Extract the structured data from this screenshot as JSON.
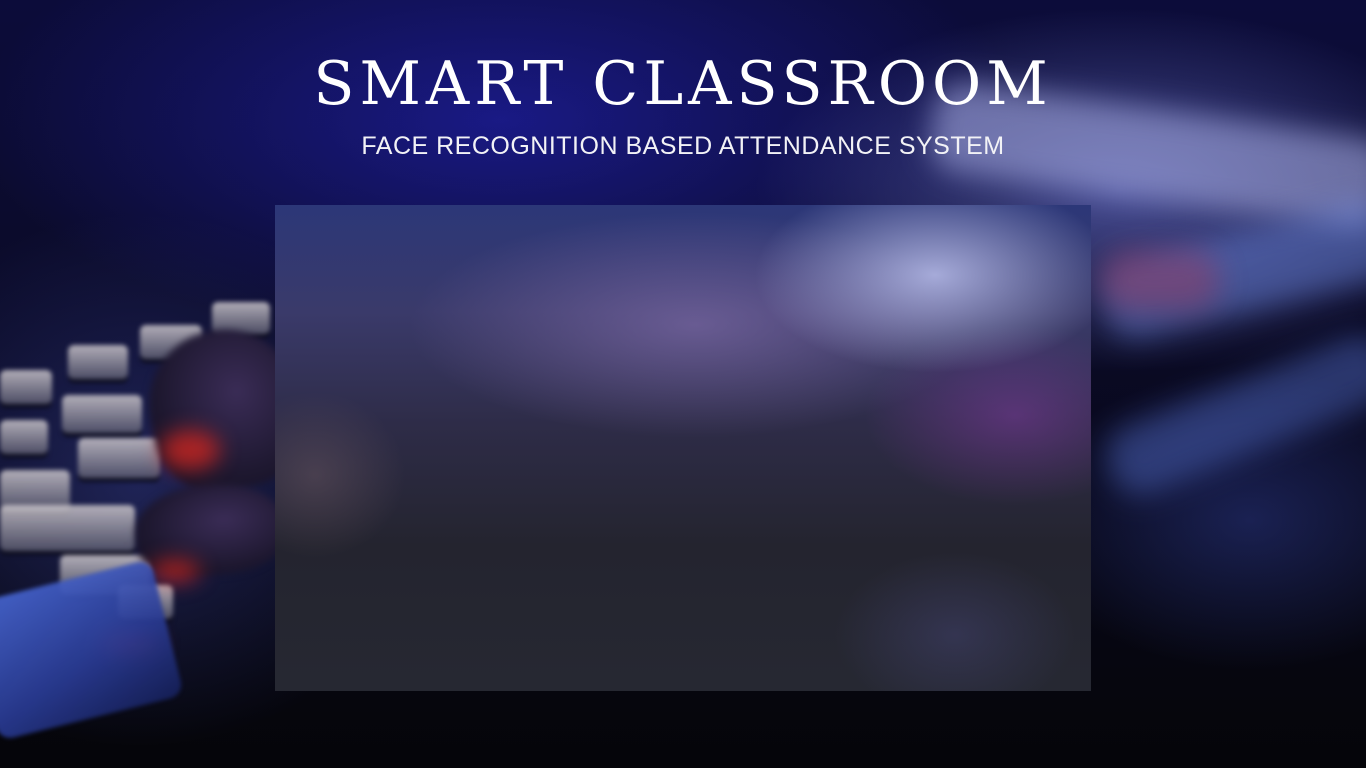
{
  "page": {
    "title": "SMART CLASSROOM",
    "subtitle": "FACE RECOGNITION BASED ATTENDANCE SYSTEM"
  },
  "colors": {
    "background_dark": "#07070d",
    "background_blue": "#0c0c3a",
    "title_text": "#ffffff",
    "panel_top": "#2c3778",
    "panel_bottom": "#262832",
    "key_glow_red": "#e6281e"
  }
}
